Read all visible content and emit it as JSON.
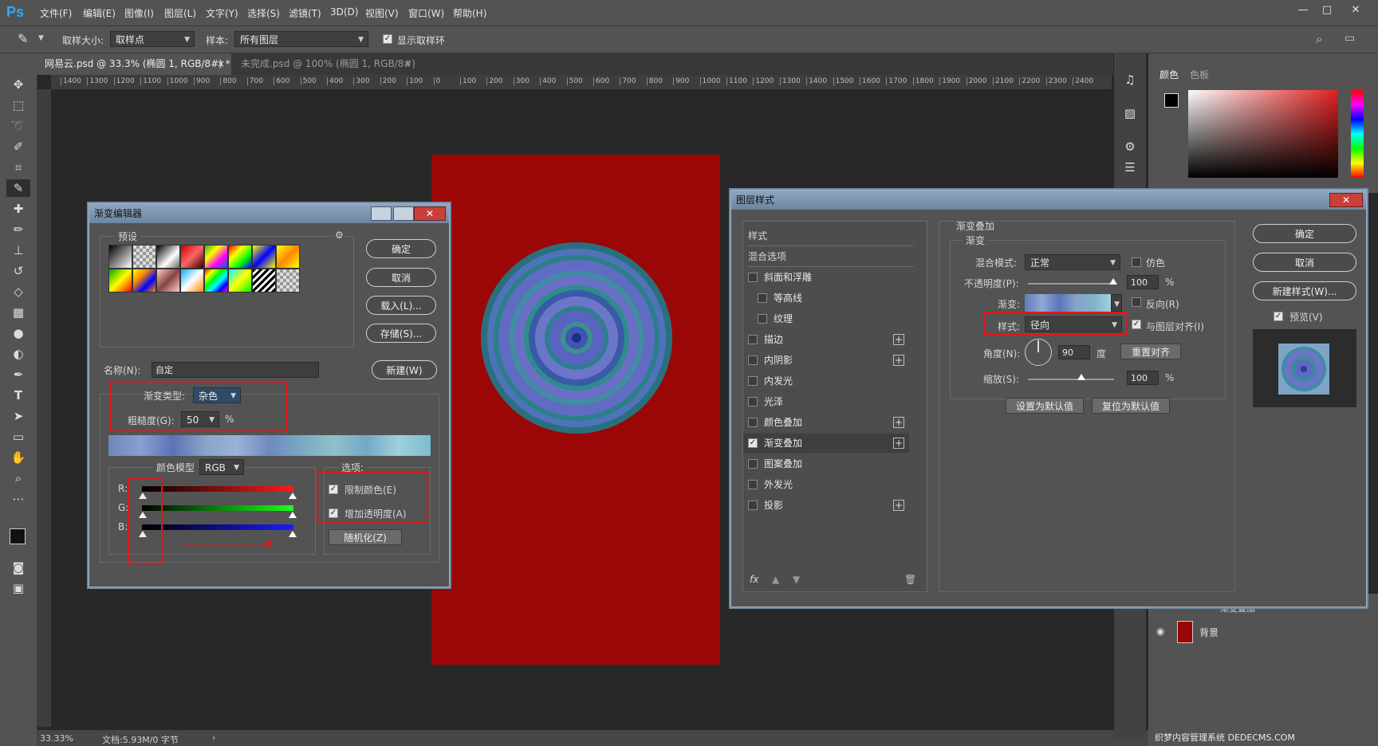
{
  "app": {
    "logo": "Ps"
  },
  "menu": [
    "文件(F)",
    "编辑(E)",
    "图像(I)",
    "图层(L)",
    "文字(Y)",
    "选择(S)",
    "滤镜(T)",
    "3D(D)",
    "视图(V)",
    "窗口(W)",
    "帮助(H)"
  ],
  "window_controls": {
    "minimize": "—",
    "maximize": "□",
    "close": "✕"
  },
  "options": {
    "sample_size_label": "取样大小:",
    "sample_size_value": "取样点",
    "sample_label": "样本:",
    "sample_value": "所有图层",
    "show_ring_label": "显示取样环"
  },
  "tabs": [
    {
      "label": "网易云.psd @ 33.3% (椭圆 1, RGB/8#) *",
      "close": "×"
    },
    {
      "label": "未完成.psd @ 100% (椭圆 1, RGB/8#)",
      "close": "×"
    }
  ],
  "ruler_h": [
    "1400",
    "1300",
    "1200",
    "1100",
    "1000",
    "900",
    "800",
    "700",
    "600",
    "500",
    "400",
    "300",
    "200",
    "100",
    "0",
    "100",
    "200",
    "300",
    "400",
    "500",
    "600",
    "700",
    "800",
    "900",
    "1000",
    "1100",
    "1200",
    "1300",
    "1400",
    "1500",
    "1600",
    "1700",
    "1800",
    "1900",
    "2000",
    "2100",
    "2200",
    "2300",
    "2400"
  ],
  "status": {
    "zoom": "33.33%",
    "doc": "文档:5.93M/0 字节",
    "arrow": "›"
  },
  "right_panel": {
    "tab_color": "颜色",
    "tab_swatches": "色板",
    "layer_effect": "渐变叠加",
    "layer_bg": "背景"
  },
  "gradient_editor": {
    "title": "渐变编辑器",
    "presets_label": "预设",
    "ok": "确定",
    "cancel": "取消",
    "load": "载入(L)...",
    "save": "存储(S)...",
    "name_label": "名称(N):",
    "name_value": "自定",
    "new_button": "新建(W)",
    "type_label": "渐变类型:",
    "type_value": "杂色",
    "roughness_label": "粗糙度(G):",
    "roughness_value": "50",
    "roughness_unit": "%",
    "color_model_label": "颜色模型",
    "color_model_value": "RGB",
    "channels": [
      "R:",
      "G:",
      "B:"
    ],
    "options_label": "选项:",
    "restrict_colors": "限制颜色(E)",
    "add_transparency": "增加透明度(A)",
    "randomize": "随机化(Z)"
  },
  "layer_style": {
    "title": "图层样式",
    "styles_header": "样式",
    "blend_options": "混合选项",
    "effects": [
      {
        "label": "斜面和浮雕",
        "checked": false,
        "plus": false,
        "indent": false
      },
      {
        "label": "等高线",
        "checked": false,
        "plus": false,
        "indent": true
      },
      {
        "label": "纹理",
        "checked": false,
        "plus": false,
        "indent": true
      },
      {
        "label": "描边",
        "checked": false,
        "plus": true,
        "indent": false
      },
      {
        "label": "内阴影",
        "checked": false,
        "plus": true,
        "indent": false
      },
      {
        "label": "内发光",
        "checked": false,
        "plus": false,
        "indent": false
      },
      {
        "label": "光泽",
        "checked": false,
        "plus": false,
        "indent": false
      },
      {
        "label": "颜色叠加",
        "checked": false,
        "plus": true,
        "indent": false
      },
      {
        "label": "渐变叠加",
        "checked": true,
        "plus": true,
        "indent": false
      },
      {
        "label": "图案叠加",
        "checked": false,
        "plus": false,
        "indent": false
      },
      {
        "label": "外发光",
        "checked": false,
        "plus": false,
        "indent": false
      },
      {
        "label": "投影",
        "checked": false,
        "plus": true,
        "indent": false
      }
    ],
    "fx_label": "fx",
    "section_title": "渐变叠加",
    "group_title": "渐变",
    "blend_mode_label": "混合模式:",
    "blend_mode_value": "正常",
    "dither_label": "仿色",
    "opacity_label": "不透明度(P):",
    "opacity_value": "100",
    "gradient_label": "渐变:",
    "reverse_label": "反向(R)",
    "style_label": "样式:",
    "style_value": "径向",
    "align_label": "与图层对齐(I)",
    "angle_label": "角度(N):",
    "angle_value": "90",
    "angle_unit": "度",
    "reset_align": "重置对齐",
    "scale_label": "缩放(S):",
    "scale_value": "100",
    "percent": "%",
    "set_default": "设置为默认值",
    "reset_default": "复位为默认值",
    "ok": "确定",
    "cancel": "取消",
    "new_style": "新建样式(W)...",
    "preview_label": "预览(V)"
  },
  "watermark": "织梦内容管理系统 DEDECMS.COM",
  "colors": {
    "accent_red": "#e0181b",
    "canvas_red": "#9b0606",
    "ps_blue": "#31a8ff"
  }
}
